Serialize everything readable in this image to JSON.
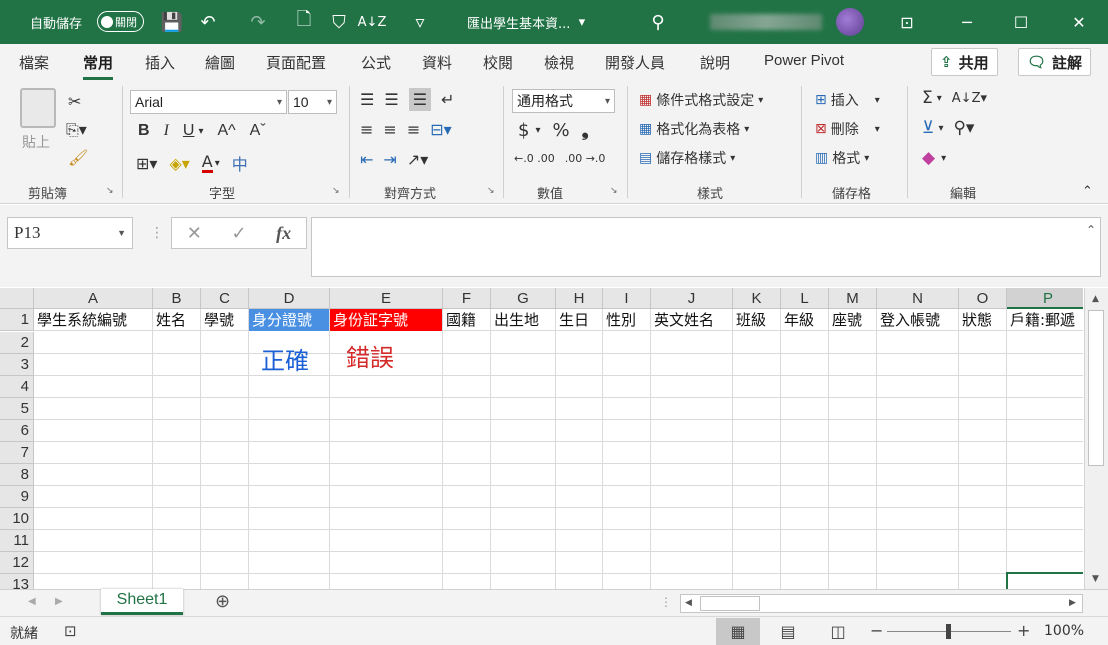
{
  "titlebar": {
    "autosave_label": "自動儲存",
    "autosave_state": "關閉",
    "doc_title": "匯出學生基本資...",
    "doc_title_arrow": "▾",
    "search_icon": "search-icon",
    "icons": {
      "save": "💾",
      "undo": "↶",
      "redo": "↷",
      "new": "🗋",
      "filter": "⛉",
      "sort": "A↓Z",
      "more": "▿",
      "search": "⚲",
      "ribbon_display": "⊡",
      "minimize": "─",
      "maximize": "☐",
      "close": "✕"
    }
  },
  "tabs": [
    "檔案",
    "常用",
    "插入",
    "繪圖",
    "頁面配置",
    "公式",
    "資料",
    "校閱",
    "檢視",
    "開發人員",
    "說明",
    "Power Pivot"
  ],
  "active_tab": "常用",
  "share": {
    "label": "共用",
    "icon": "⇪"
  },
  "comments": {
    "label": "註解",
    "icon": "🗨"
  },
  "ribbon": {
    "clipboard": {
      "label": "剪貼簿",
      "paste": "貼上"
    },
    "font": {
      "label": "字型",
      "name": "Arial",
      "size": "10",
      "bold": "B",
      "italic": "I",
      "underline": "U",
      "grow": "A^",
      "shrink": "Aˇ",
      "font_color": "A",
      "phonetic": "中"
    },
    "alignment": {
      "label": "對齊方式"
    },
    "number": {
      "label": "數值",
      "format": "通用格式",
      "currency": "$",
      "percent": "%",
      "comma": "❟",
      "inc_decimal": "←.0 .00",
      "dec_decimal": ".00 →.0"
    },
    "styles": {
      "label": "樣式",
      "conditional": "條件式格式設定",
      "as_table": "格式化為表格",
      "cell_styles": "儲存格樣式"
    },
    "cells": {
      "label": "儲存格",
      "insert": "插入",
      "delete": "刪除",
      "format": "格式"
    },
    "editing": {
      "label": "編輯"
    }
  },
  "formula_bar": {
    "namebox": "P13",
    "cancel": "✕",
    "enter": "✓",
    "fx": "fx",
    "formula": ""
  },
  "columns": [
    "A",
    "B",
    "C",
    "D",
    "E",
    "F",
    "G",
    "H",
    "I",
    "J",
    "K",
    "L",
    "M",
    "N",
    "O",
    "P"
  ],
  "rows": [
    "1",
    "2",
    "3",
    "4",
    "5",
    "6",
    "7",
    "8",
    "9",
    "10",
    "11",
    "12",
    "13"
  ],
  "header_row": [
    "學生系統編號",
    "姓名",
    "學號",
    "身分證號",
    "身份証字號",
    "國籍",
    "出生地",
    "生日",
    "性別",
    "英文姓名",
    "班級",
    "年級",
    "座號",
    "登入帳號",
    "狀態",
    "戶籍:郵遞"
  ],
  "notes": {
    "correct": "正確",
    "wrong": "錯誤"
  },
  "colors": {
    "excel_green": "#217346",
    "correct_fill": "#4a90e2",
    "wrong_fill": "#ff0000",
    "correct_text": "#1a5fd6",
    "wrong_text": "#d42a2a"
  },
  "sheet_tabs": [
    "Sheet1"
  ],
  "status": {
    "ready": "就緒",
    "zoom": "100%",
    "zoom_minus": "−",
    "zoom_plus": "+"
  }
}
